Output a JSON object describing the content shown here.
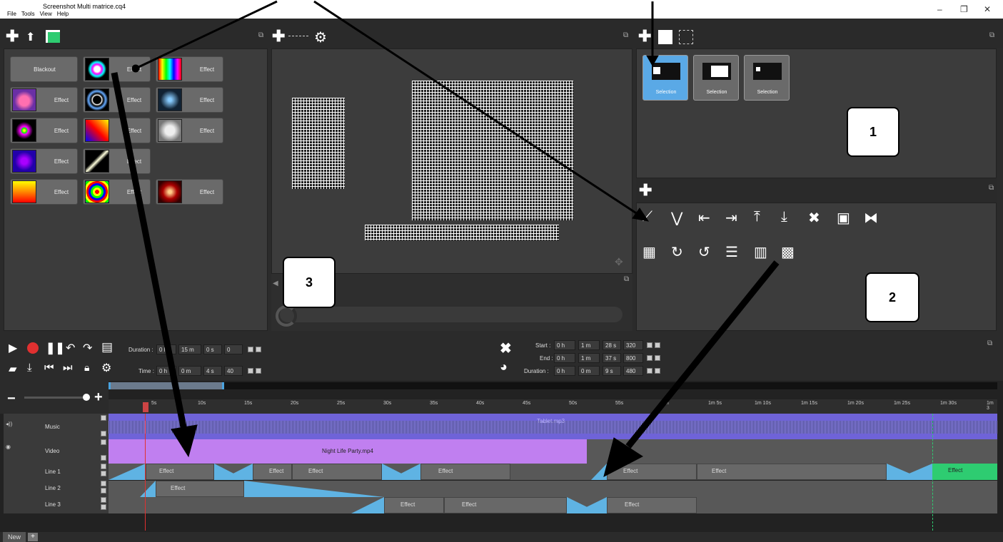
{
  "window": {
    "title": "Screenshot Multi matrice.cq4",
    "menu": [
      "File",
      "Tools",
      "View",
      "Help"
    ],
    "controls": [
      "–",
      "❐",
      "✕"
    ]
  },
  "effects_panel": {
    "buttons": [
      {
        "label": "Blackout",
        "thumb": ""
      },
      {
        "label": "Effect",
        "thumb": "rainbow-ring"
      },
      {
        "label": "Effect",
        "thumb": "color-bars"
      },
      {
        "label": "Effect",
        "thumb": "heart"
      },
      {
        "label": "Effect",
        "thumb": "tunnel"
      },
      {
        "label": "Effect",
        "thumb": "blue-dots"
      },
      {
        "label": "Effect",
        "thumb": "fireworks"
      },
      {
        "label": "Effect",
        "thumb": "fire-blue"
      },
      {
        "label": "Effect",
        "thumb": "white-face"
      },
      {
        "label": "Effect",
        "thumb": "purple-swirl"
      },
      {
        "label": "Effect",
        "thumb": "light-beam"
      },
      {
        "label": "Effect",
        "thumb": "equalizer"
      },
      {
        "label": "Effect",
        "thumb": "rainbow-rings"
      },
      {
        "label": "Effect",
        "thumb": "red-figure"
      }
    ]
  },
  "selection_panel": {
    "items": [
      "Selection",
      "Selection",
      "Selection"
    ]
  },
  "callouts": {
    "c1": "1",
    "c2": "2",
    "c3": "3"
  },
  "transport": {
    "duration_label": "Duration :",
    "duration": [
      "0 h",
      "15 m",
      "0 s",
      "0"
    ],
    "time_label": "Time :",
    "time": [
      "0 h",
      "0 m",
      "4 s",
      "40"
    ]
  },
  "clip_info": {
    "start_label": "Start :",
    "start": [
      "0 h",
      "1 m",
      "28 s",
      "320"
    ],
    "end_label": "End :",
    "end": [
      "0 h",
      "1 m",
      "37 s",
      "800"
    ],
    "duration_label": "Duration :",
    "duration": [
      "0 h",
      "0 m",
      "9 s",
      "480"
    ]
  },
  "ruler": [
    "5s",
    "10s",
    "15s",
    "20s",
    "25s",
    "30s",
    "35s",
    "40s",
    "45s",
    "50s",
    "55s",
    "1m",
    "1m 5s",
    "1m 10s",
    "1m 15s",
    "1m 20s",
    "1m 25s",
    "1m 30s",
    "1m 3"
  ],
  "tracks": {
    "music": {
      "label": "Music",
      "file": "Tablet.mp3"
    },
    "video": {
      "label": "Video",
      "file": "Night Life Party.mp4"
    },
    "line1": {
      "label": "Line 1"
    },
    "line2": {
      "label": "Line 2"
    },
    "line3": {
      "label": "Line 3"
    }
  },
  "clip_label": "Effect",
  "bottom_tab": {
    "label": "New"
  }
}
